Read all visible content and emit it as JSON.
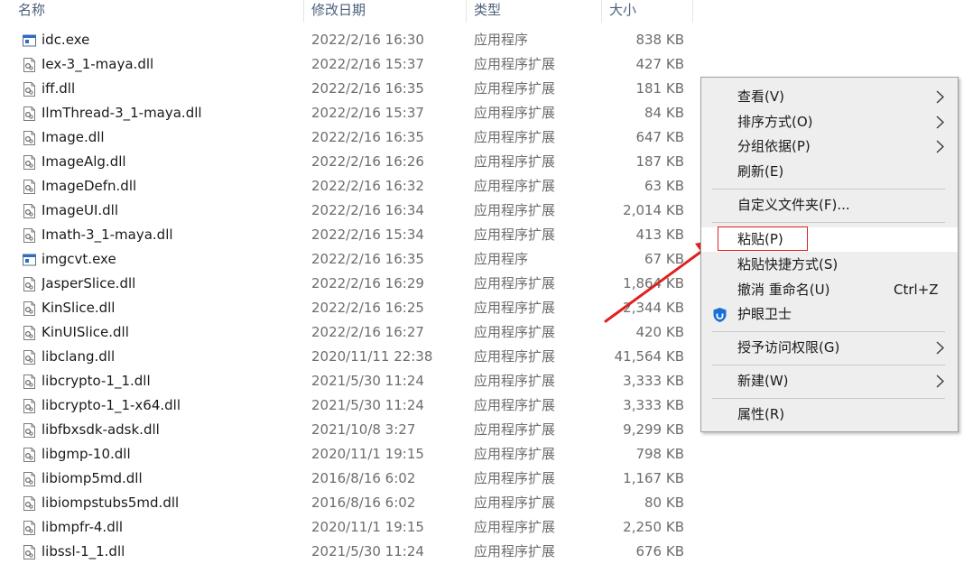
{
  "columns": {
    "name": "名称",
    "date": "修改日期",
    "type": "类型",
    "size": "大小"
  },
  "files": [
    {
      "icon": "exe-icon",
      "name": "idc.exe",
      "date": "2022/2/16 16:30",
      "type": "应用程序",
      "size": "838 KB"
    },
    {
      "icon": "dll-icon",
      "name": "Iex-3_1-maya.dll",
      "date": "2022/2/16 15:37",
      "type": "应用程序扩展",
      "size": "427 KB"
    },
    {
      "icon": "dll-icon",
      "name": "iff.dll",
      "date": "2022/2/16 16:35",
      "type": "应用程序扩展",
      "size": "181 KB"
    },
    {
      "icon": "dll-icon",
      "name": "IlmThread-3_1-maya.dll",
      "date": "2022/2/16 15:37",
      "type": "应用程序扩展",
      "size": "84 KB"
    },
    {
      "icon": "dll-icon",
      "name": "Image.dll",
      "date": "2022/2/16 16:35",
      "type": "应用程序扩展",
      "size": "647 KB"
    },
    {
      "icon": "dll-icon",
      "name": "ImageAlg.dll",
      "date": "2022/2/16 16:26",
      "type": "应用程序扩展",
      "size": "187 KB"
    },
    {
      "icon": "dll-icon",
      "name": "ImageDefn.dll",
      "date": "2022/2/16 16:32",
      "type": "应用程序扩展",
      "size": "63 KB"
    },
    {
      "icon": "dll-icon",
      "name": "ImageUI.dll",
      "date": "2022/2/16 16:34",
      "type": "应用程序扩展",
      "size": "2,014 KB"
    },
    {
      "icon": "dll-icon",
      "name": "Imath-3_1-maya.dll",
      "date": "2022/2/16 15:34",
      "type": "应用程序扩展",
      "size": "413 KB"
    },
    {
      "icon": "exe-icon",
      "name": "imgcvt.exe",
      "date": "2022/2/16 16:35",
      "type": "应用程序",
      "size": "67 KB"
    },
    {
      "icon": "dll-icon",
      "name": "JasperSlice.dll",
      "date": "2022/2/16 16:29",
      "type": "应用程序扩展",
      "size": "1,864 KB"
    },
    {
      "icon": "dll-icon",
      "name": "KinSlice.dll",
      "date": "2022/2/16 16:25",
      "type": "应用程序扩展",
      "size": "2,344 KB"
    },
    {
      "icon": "dll-icon",
      "name": "KinUISlice.dll",
      "date": "2022/2/16 16:27",
      "type": "应用程序扩展",
      "size": "420 KB"
    },
    {
      "icon": "dll-icon",
      "name": "libclang.dll",
      "date": "2020/11/11 22:38",
      "type": "应用程序扩展",
      "size": "41,564 KB"
    },
    {
      "icon": "dll-icon",
      "name": "libcrypto-1_1.dll",
      "date": "2021/5/30 11:24",
      "type": "应用程序扩展",
      "size": "3,333 KB"
    },
    {
      "icon": "dll-icon",
      "name": "libcrypto-1_1-x64.dll",
      "date": "2021/5/30 11:24",
      "type": "应用程序扩展",
      "size": "3,333 KB"
    },
    {
      "icon": "dll-icon",
      "name": "libfbxsdk-adsk.dll",
      "date": "2021/10/8 3:27",
      "type": "应用程序扩展",
      "size": "9,299 KB"
    },
    {
      "icon": "dll-icon",
      "name": "libgmp-10.dll",
      "date": "2020/11/1 19:15",
      "type": "应用程序扩展",
      "size": "798 KB"
    },
    {
      "icon": "dll-icon",
      "name": "libiomp5md.dll",
      "date": "2016/8/16 6:02",
      "type": "应用程序扩展",
      "size": "1,167 KB"
    },
    {
      "icon": "dll-icon",
      "name": "libiompstubs5md.dll",
      "date": "2016/8/16 6:02",
      "type": "应用程序扩展",
      "size": "80 KB"
    },
    {
      "icon": "dll-icon",
      "name": "libmpfr-4.dll",
      "date": "2020/11/1 19:15",
      "type": "应用程序扩展",
      "size": "2,250 KB"
    },
    {
      "icon": "dll-icon",
      "name": "libssl-1_1.dll",
      "date": "2021/5/30 11:24",
      "type": "应用程序扩展",
      "size": "676 KB"
    }
  ],
  "context_menu": {
    "view": "查看(V)",
    "sort": "排序方式(O)",
    "group": "分组依据(P)",
    "refresh": "刷新(E)",
    "customize": "自定义文件夹(F)...",
    "paste": "粘贴(P)",
    "paste_shortcut": "粘贴快捷方式(S)",
    "undo": "撤消 重命名(U)",
    "undo_shortcut": "Ctrl+Z",
    "eye_guard": "护眼卫士",
    "grant_access": "授予访问权限(G)",
    "new": "新建(W)",
    "properties": "属性(R)"
  },
  "colors": {
    "highlight_box": "#e02020",
    "arrow": "#e02020",
    "menu_bg": "#eeeeee"
  }
}
